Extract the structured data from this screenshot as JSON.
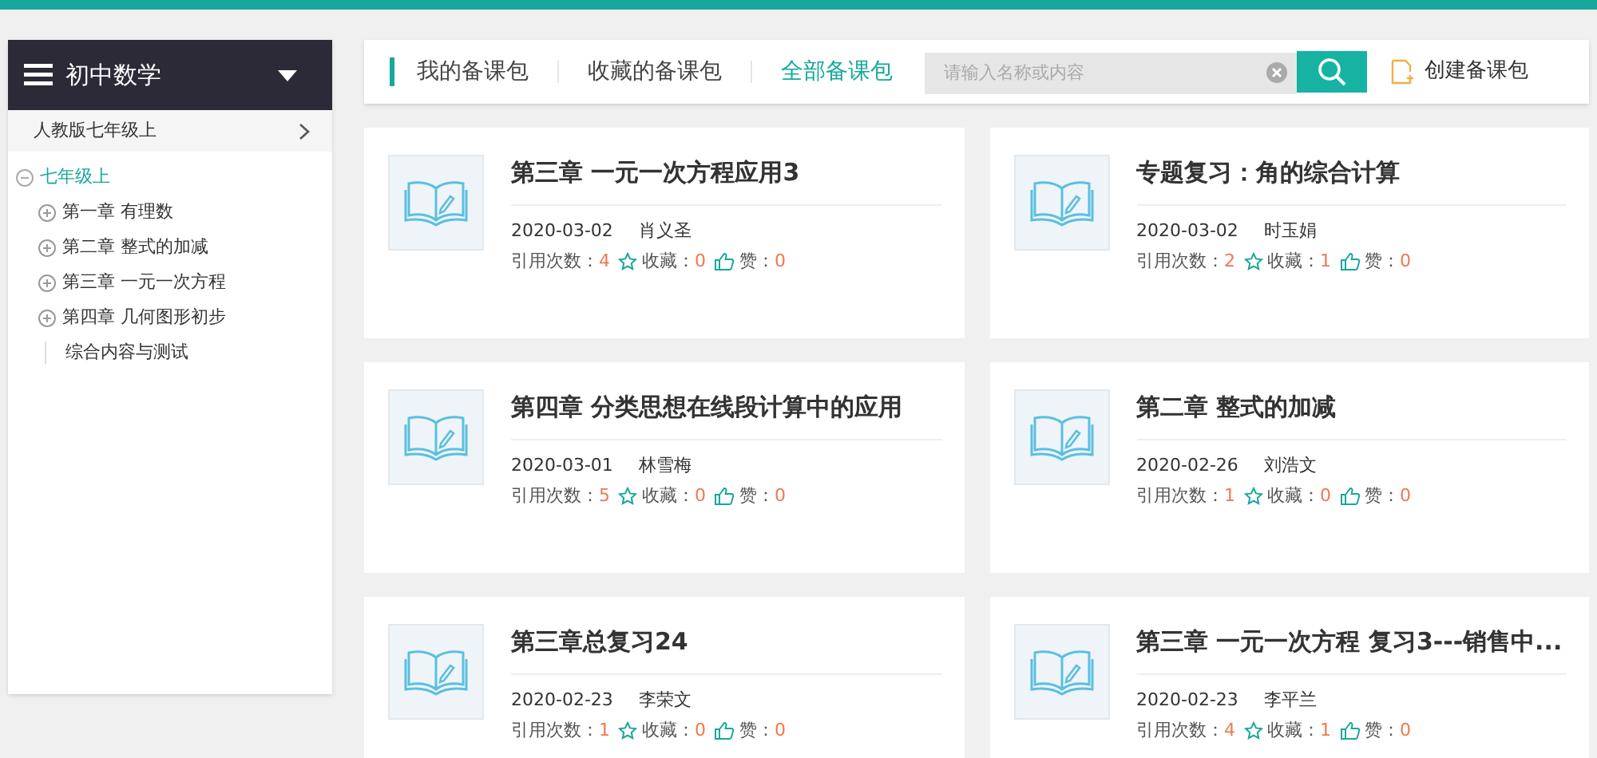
{
  "sidebar": {
    "title": "初中数学",
    "textbook": "人教版七年级上",
    "tree": [
      {
        "label": "七年级上",
        "selected": true,
        "expanded": true,
        "children": [
          {
            "label": "第一章 有理数",
            "selected": false,
            "expanded": false
          },
          {
            "label": "第二章 整式的加减",
            "selected": false,
            "expanded": false
          },
          {
            "label": "第三章 一元一次方程",
            "selected": false,
            "expanded": false
          },
          {
            "label": "第四章 几何图形初步",
            "selected": false,
            "expanded": false
          },
          {
            "label": "综合内容与测试",
            "selected": false
          }
        ]
      }
    ]
  },
  "tabs": [
    {
      "label": "我的备课包",
      "selected": false
    },
    {
      "label": "收藏的备课包",
      "selected": false
    },
    {
      "label": "全部备课包",
      "selected": true
    }
  ],
  "search": {
    "placeholder": "请输入名称或内容"
  },
  "create_button": "创建备课包",
  "cards": [
    {
      "title": "第三章 一元一次方程应用3",
      "date": "2020-03-02",
      "author": "肖义圣",
      "stats": [
        {
          "kind": "citations",
          "label": "引用次数：",
          "value": "4"
        },
        {
          "kind": "favorites",
          "label": "收藏：",
          "value": "0"
        },
        {
          "kind": "likes",
          "label": "赞：",
          "value": "0"
        }
      ]
    },
    {
      "title": "专题复习：角的综合计算",
      "date": "2020-03-02",
      "author": "时玉娟",
      "stats": [
        {
          "kind": "citations",
          "label": "引用次数：",
          "value": "2"
        },
        {
          "kind": "favorites",
          "label": "收藏：",
          "value": "1"
        },
        {
          "kind": "likes",
          "label": "赞：",
          "value": "0"
        }
      ]
    },
    {
      "title": "第四章 分类思想在线段计算中的应用",
      "date": "2020-03-01",
      "author": "林雪梅",
      "stats": [
        {
          "kind": "citations",
          "label": "引用次数：",
          "value": "5"
        },
        {
          "kind": "favorites",
          "label": "收藏：",
          "value": "0"
        },
        {
          "kind": "likes",
          "label": "赞：",
          "value": "0"
        }
      ]
    },
    {
      "title": "第二章 整式的加减",
      "date": "2020-02-26",
      "author": "刘浩文",
      "stats": [
        {
          "kind": "citations",
          "label": "引用次数：",
          "value": "1"
        },
        {
          "kind": "favorites",
          "label": "收藏：",
          "value": "0"
        },
        {
          "kind": "likes",
          "label": "赞：",
          "value": "0"
        }
      ]
    },
    {
      "title": "第三章总复习24",
      "date": "2020-02-23",
      "author": "李荣文",
      "stats": [
        {
          "kind": "citations",
          "label": "引用次数：",
          "value": "1"
        },
        {
          "kind": "favorites",
          "label": "收藏：",
          "value": "0"
        },
        {
          "kind": "likes",
          "label": "赞：",
          "value": "0"
        }
      ]
    },
    {
      "title": "第三章 一元一次方程 复习3---销售中...",
      "date": "2020-02-23",
      "author": "李平兰",
      "stats": [
        {
          "kind": "citations",
          "label": "引用次数：",
          "value": "4"
        },
        {
          "kind": "favorites",
          "label": "收藏：",
          "value": "1"
        },
        {
          "kind": "likes",
          "label": "赞：",
          "value": "0"
        }
      ]
    }
  ]
}
